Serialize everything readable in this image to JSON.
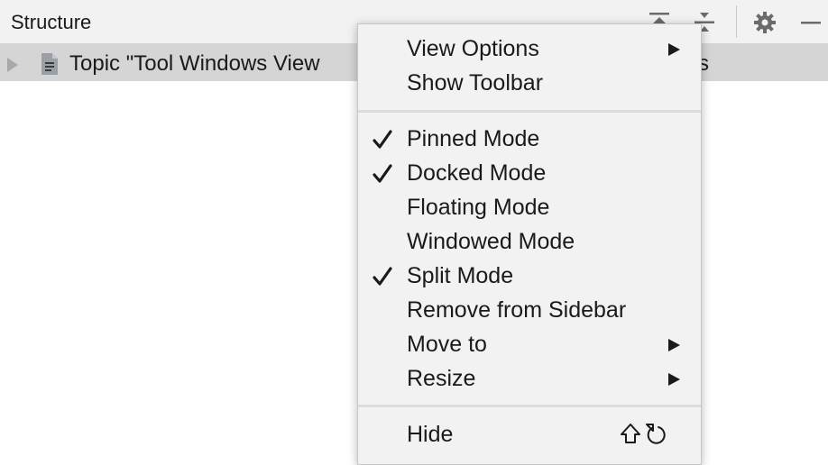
{
  "header": {
    "title": "Structure"
  },
  "tree": {
    "node_label": "Topic \"Tool Windows View",
    "node_label_tail": "s"
  },
  "menu": {
    "view_options": "View Options",
    "show_toolbar": "Show Toolbar",
    "pinned_mode": "Pinned Mode",
    "docked_mode": "Docked Mode",
    "floating_mode": "Floating Mode",
    "windowed_mode": "Windowed Mode",
    "split_mode": "Split Mode",
    "remove_from_sidebar": "Remove from Sidebar",
    "move_to": "Move to",
    "resize": "Resize",
    "hide": "Hide",
    "checked": {
      "pinned_mode": true,
      "docked_mode": true,
      "split_mode": true
    }
  },
  "icons": [
    "expand-all-icon",
    "collapse-all-icon",
    "gear-icon",
    "minimize-icon",
    "tree-expand-icon",
    "file-icon",
    "checkmark-icon",
    "submenu-arrow-icon",
    "shift-key-icon",
    "escape-key-icon"
  ]
}
